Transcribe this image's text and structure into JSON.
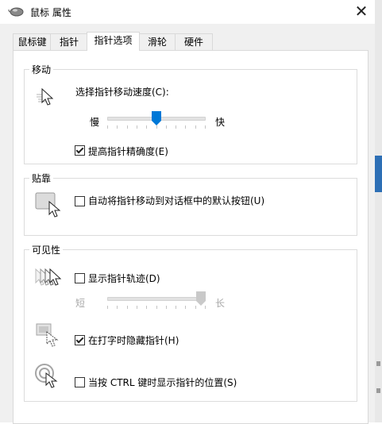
{
  "window": {
    "title": "鼠标 属性",
    "close_symbol": "✕"
  },
  "tabs": [
    {
      "label": "鼠标键",
      "active": false
    },
    {
      "label": "指针",
      "active": false
    },
    {
      "label": "指针选项",
      "active": true
    },
    {
      "label": "滑轮",
      "active": false
    },
    {
      "label": "硬件",
      "active": false
    }
  ],
  "motion": {
    "group_label": "移动",
    "speed_label": "选择指针移动速度(C):",
    "slow_label": "慢",
    "fast_label": "快",
    "speed_level": 0.5,
    "precision_label": "提高指针精确度(E)",
    "precision_checked": true
  },
  "snap": {
    "group_label": "贴靠",
    "snap_label": "自动将指针移动到对话框中的默认按钮(U)",
    "snap_checked": false
  },
  "visibility": {
    "group_label": "可见性",
    "trails_label": "显示指针轨迹(D)",
    "trails_checked": false,
    "short_label": "短",
    "long_label": "长",
    "trails_level": 1.0,
    "hide_label": "在打字时隐藏指针(H)",
    "hide_checked": true,
    "ctrl_label": "当按 CTRL 键时显示指针的位置(S)",
    "ctrl_checked": false
  },
  "colors": {
    "accent": "#0078d7",
    "disabled_thumb": "#c9c9c9"
  },
  "icons": [
    "mouse-icon",
    "close-icon",
    "pointer-speed-icon",
    "snap-to-icon",
    "pointer-trails-icon",
    "hide-pointer-icon",
    "locate-pointer-icon"
  ]
}
